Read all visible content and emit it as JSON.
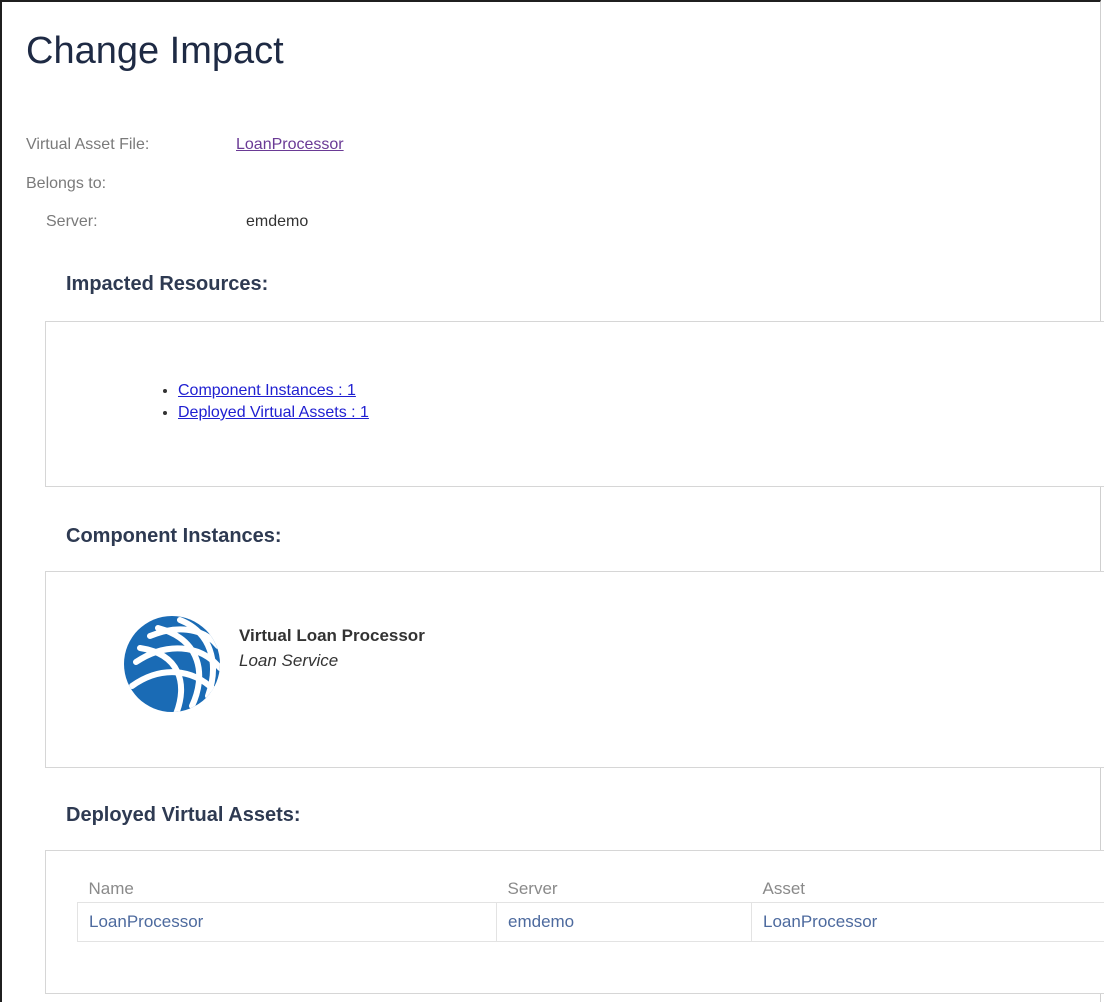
{
  "page": {
    "title": "Change Impact"
  },
  "meta": {
    "virtual_asset_file_label": "Virtual Asset File:",
    "virtual_asset_file_link": "LoanProcessor",
    "belongs_to_label": "Belongs to:",
    "server_label": "Server:",
    "server_value": "emdemo"
  },
  "impacted_resources": {
    "heading": "Impacted Resources:",
    "items": [
      {
        "label": "Component Instances : 1"
      },
      {
        "label": "Deployed Virtual Assets : 1"
      }
    ]
  },
  "component_instances": {
    "heading": "Component Instances:",
    "items": [
      {
        "icon": "globe-icon",
        "name": "Virtual Loan Processor",
        "description": "Loan Service"
      }
    ]
  },
  "deployed_virtual_assets": {
    "heading": "Deployed Virtual Assets:",
    "columns": [
      "Name",
      "Server",
      "Asset"
    ],
    "rows": [
      [
        "LoanProcessor",
        "emdemo",
        "LoanProcessor"
      ]
    ]
  },
  "colors": {
    "title": "#1e2a44",
    "link_visited": "#6a3a95",
    "link": "#1f1fd1",
    "table_text": "#4d6a9e",
    "globe": "#1a6bb5"
  }
}
